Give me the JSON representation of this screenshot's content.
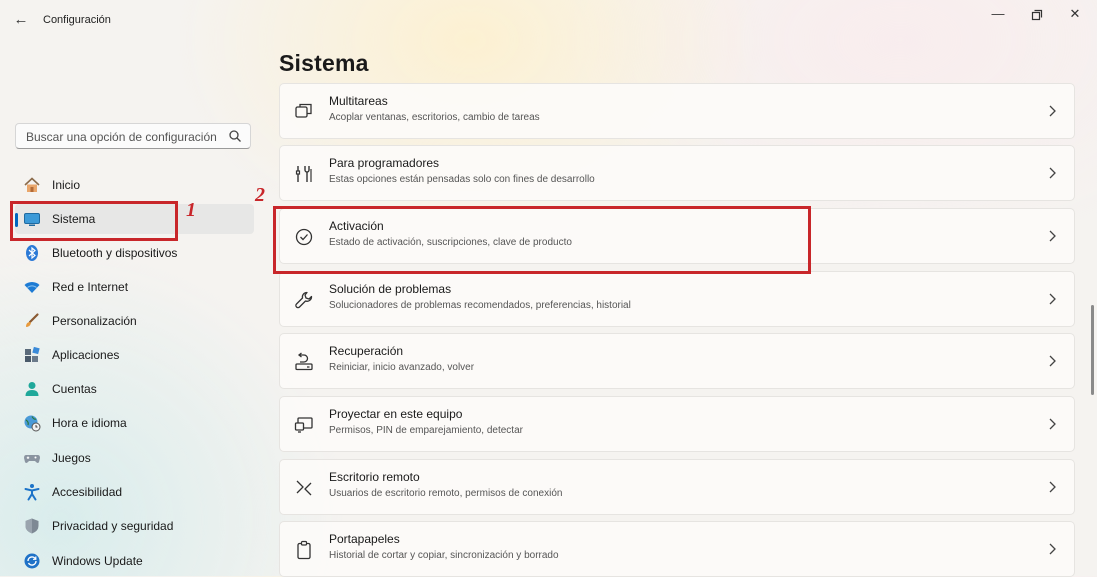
{
  "app": {
    "title": "Configuración",
    "back_icon": "back-arrow-icon"
  },
  "window_controls": [
    "minimize-icon",
    "maximize-icon",
    "close-icon"
  ],
  "search": {
    "placeholder": "Buscar una opción de configuración"
  },
  "sidebar": {
    "items": [
      {
        "label": "Inicio",
        "icon": "home-icon"
      },
      {
        "label": "Sistema",
        "icon": "system-icon",
        "selected": true
      },
      {
        "label": "Bluetooth y dispositivos",
        "icon": "bluetooth-icon"
      },
      {
        "label": "Red e Internet",
        "icon": "wifi-icon"
      },
      {
        "label": "Personalización",
        "icon": "brush-icon"
      },
      {
        "label": "Aplicaciones",
        "icon": "apps-icon"
      },
      {
        "label": "Cuentas",
        "icon": "account-icon"
      },
      {
        "label": "Hora e idioma",
        "icon": "globe-clock-icon"
      },
      {
        "label": "Juegos",
        "icon": "gamepad-icon"
      },
      {
        "label": "Accesibilidad",
        "icon": "accessibility-icon"
      },
      {
        "label": "Privacidad y seguridad",
        "icon": "shield-icon"
      },
      {
        "label": "Windows Update",
        "icon": "update-icon"
      }
    ]
  },
  "main": {
    "title": "Sistema",
    "cards": [
      {
        "title": "Multitareas",
        "desc": "Acoplar ventanas, escritorios, cambio de tareas",
        "icon": "multitask-icon"
      },
      {
        "title": "Para programadores",
        "desc": "Estas opciones están pensadas solo con fines de desarrollo",
        "icon": "developer-tools-icon"
      },
      {
        "title": "Activación",
        "desc": "Estado de activación, suscripciones, clave de producto",
        "icon": "check-circle-icon"
      },
      {
        "title": "Solución de problemas",
        "desc": "Solucionadores de problemas recomendados, preferencias, historial",
        "icon": "wrench-icon"
      },
      {
        "title": "Recuperación",
        "desc": "Reiniciar, inicio avanzado, volver",
        "icon": "recovery-icon"
      },
      {
        "title": "Proyectar en este equipo",
        "desc": "Permisos, PIN de emparejamiento, detectar",
        "icon": "project-icon"
      },
      {
        "title": "Escritorio remoto",
        "desc": "Usuarios de escritorio remoto, permisos de conexión",
        "icon": "remote-desktop-icon"
      },
      {
        "title": "Portapapeles",
        "desc": "Historial de cortar y copiar, sincronización y borrado",
        "icon": "clipboard-icon"
      }
    ]
  },
  "annotations": {
    "one": "1",
    "two": "2",
    "color": "#c8262a"
  },
  "colors": {
    "accent": "#0067c0",
    "annotation": "#c8262a"
  }
}
